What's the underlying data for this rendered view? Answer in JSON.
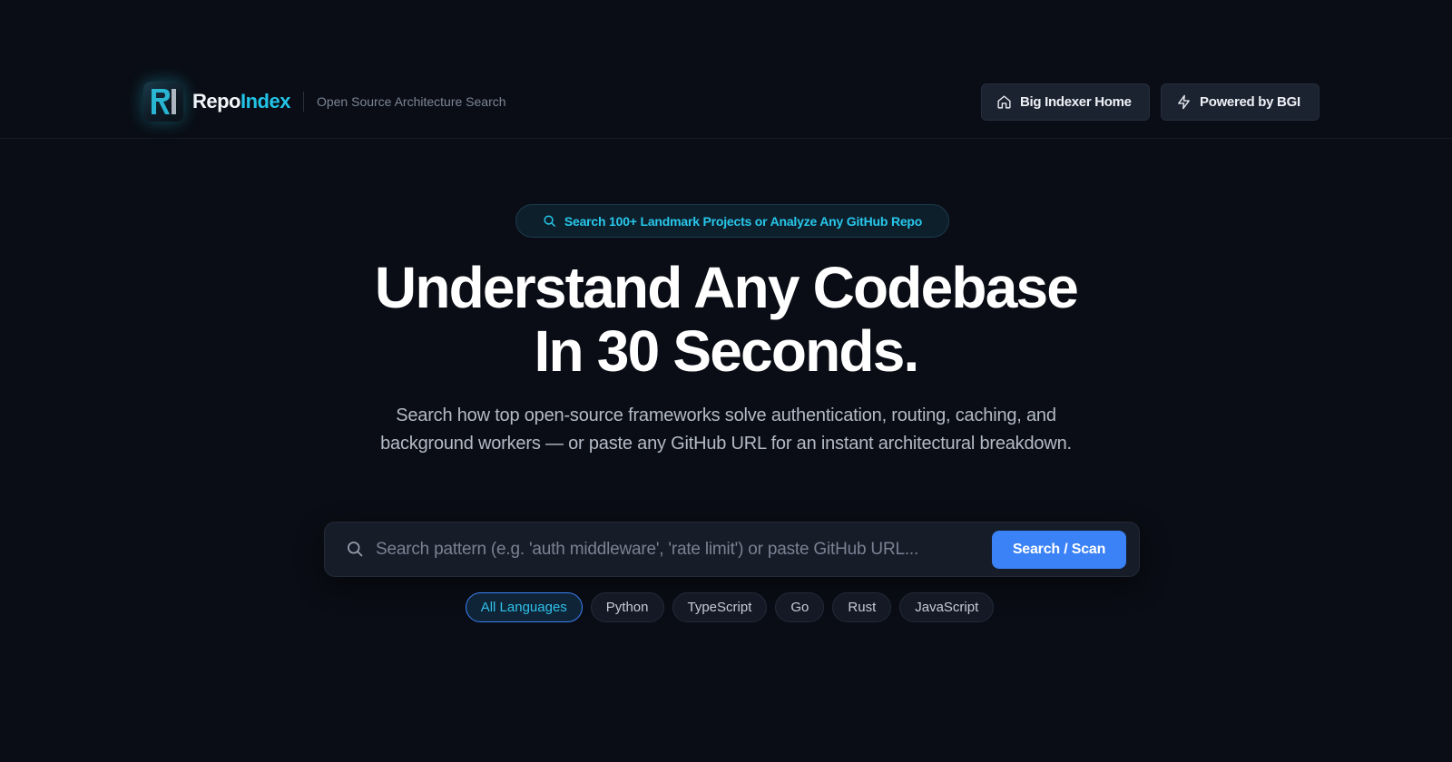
{
  "header": {
    "brand_name_part1": "Repo",
    "brand_name_part2": "Index",
    "brand_tagline": "Open Source Architecture Search",
    "logo_letters": "RI",
    "nav": [
      {
        "label": "Big Indexer Home",
        "icon": "home-icon"
      },
      {
        "label": "Powered by BGI",
        "icon": "bolt-icon"
      }
    ]
  },
  "hero": {
    "pill_text": "Search 100+ Landmark Projects or Analyze Any GitHub Repo",
    "title_line1": "Understand Any Codebase",
    "title_line2": "In 30 Seconds.",
    "subtitle": "Search how top open-source frameworks solve authentication, routing, caching, and background workers — or paste any GitHub URL for an instant architectural breakdown."
  },
  "search": {
    "placeholder": "Search pattern (e.g. 'auth middleware', 'rate limit') or paste GitHub URL...",
    "value": "",
    "button_label": "Search / Scan"
  },
  "languages": {
    "selected": "All Languages",
    "options": [
      "All Languages",
      "Python",
      "TypeScript",
      "Go",
      "Rust",
      "JavaScript"
    ]
  },
  "colors": {
    "background": "#0a0d15",
    "accent_cyan": "#22c3e6",
    "accent_blue": "#3b82f6"
  }
}
